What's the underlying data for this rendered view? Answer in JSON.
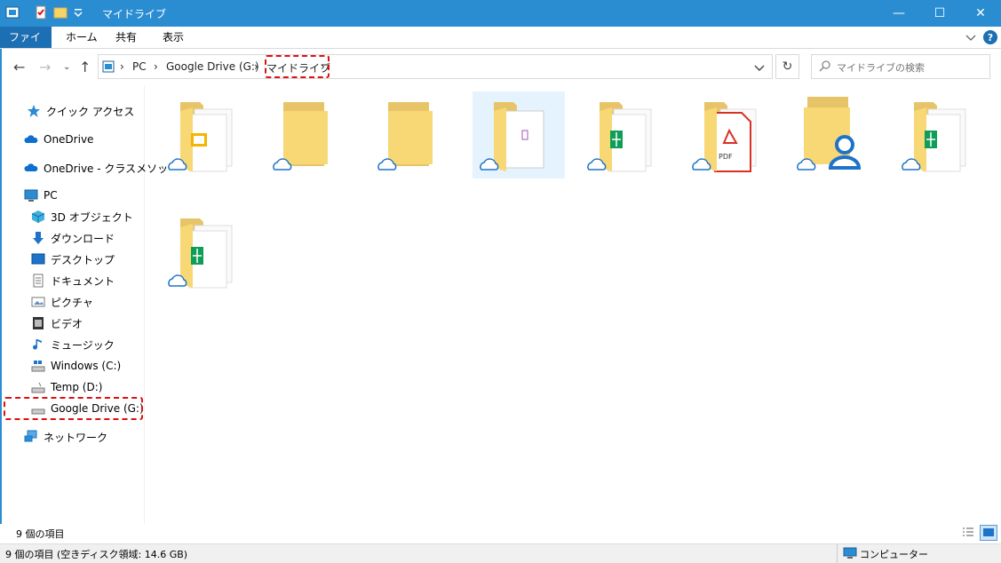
{
  "window": {
    "title": "マイドライブ"
  },
  "window_controls": {
    "minimize": "—",
    "maximize": "☐",
    "close": "✕"
  },
  "ribbon": {
    "tabs": [
      "ファイル",
      "ホーム",
      "共有",
      "表示"
    ]
  },
  "address": {
    "crumbs": [
      "PC",
      "Google Drive (G:)",
      "マイドライブ"
    ],
    "separator": "›"
  },
  "search": {
    "placeholder": "マイドライブの検索"
  },
  "sidebar": {
    "items": [
      {
        "label": "クイック アクセス",
        "icon": "star-icon"
      },
      {
        "label": "OneDrive",
        "icon": "cloud-icon"
      },
      {
        "label": "OneDrive - クラスメソッ",
        "icon": "cloud-icon"
      },
      {
        "label": "PC",
        "icon": "monitor-icon"
      },
      {
        "label": "3D オブジェクト",
        "icon": "cube-icon"
      },
      {
        "label": "ダウンロード",
        "icon": "download-icon"
      },
      {
        "label": "デスクトップ",
        "icon": "desktop-icon"
      },
      {
        "label": "ドキュメント",
        "icon": "document-icon"
      },
      {
        "label": "ピクチャ",
        "icon": "picture-icon"
      },
      {
        "label": "ビデオ",
        "icon": "video-icon"
      },
      {
        "label": "ミュージック",
        "icon": "music-icon"
      },
      {
        "label": "Windows (C:)",
        "icon": "drive-icon"
      },
      {
        "label": "Temp (D:)",
        "icon": "drive-icon"
      },
      {
        "label": "Google Drive (G:)",
        "icon": "drive-icon"
      },
      {
        "label": "ネットワーク",
        "icon": "network-icon"
      }
    ]
  },
  "content": {
    "folders": [
      {
        "icon": "folder-slides-icon"
      },
      {
        "icon": "folder-icon"
      },
      {
        "icon": "folder-icon"
      },
      {
        "icon": "folder-file-icon",
        "selected": true
      },
      {
        "icon": "folder-sheets-icon"
      },
      {
        "icon": "folder-pdf-icon",
        "pdf_label": "PDF"
      },
      {
        "icon": "folder-shared-icon"
      },
      {
        "icon": "folder-sheets-icon"
      },
      {
        "icon": "folder-sheets-icon"
      }
    ]
  },
  "status": {
    "item_count": "9 個の項目",
    "disk_info": "9 個の項目 (空きディスク領域: 14.6 GB)",
    "computer_label": "コンピューター"
  },
  "colors": {
    "titlebar": "#2b8dd1",
    "file_tab": "#1c6fb3",
    "highlight": "#d11111",
    "selection": "#e5f3ff"
  }
}
